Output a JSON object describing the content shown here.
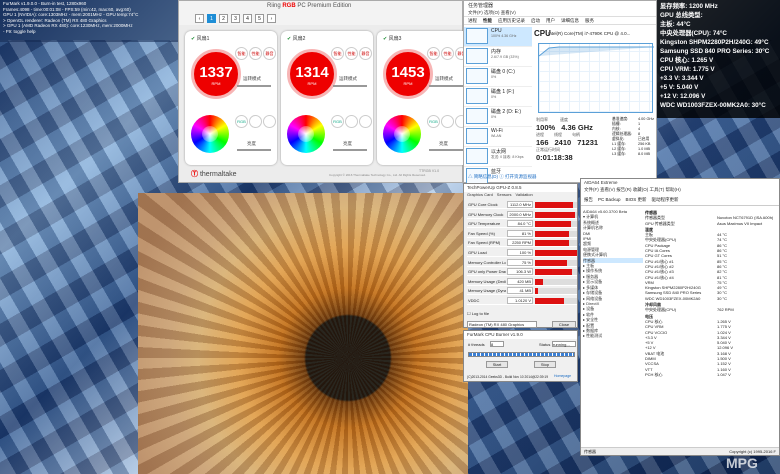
{
  "overlay_tl": {
    "lines": [
      "FurMark v1.9.0.0 - Burn-in test, 1280x960",
      "Frames:4098 - time:00:01:08 - FPS:59 (min:42, max:60, avg:60)",
      "GPU 1 (NVIDIA): core:1303MHz - mem:2001MHz - GPU temp:74°C",
      "> OpenGL renderer: Radeon (TM) RX 480 Graphics",
      "> GPU 1 (AMD Radeon RX 480): core:1230MHz, mem:2000MHz",
      "- F9: toggle help"
    ]
  },
  "tt": {
    "title_pre": "Riing ",
    "title_brand": "RGB",
    "title_post": " PC Premium Edition",
    "pages": [
      "1",
      "2",
      "3",
      "4",
      "5"
    ],
    "brand_pre": "Ⓣ ",
    "brand": "thermaltake",
    "fans": [
      {
        "label": "风扇1",
        "rpm": "1337",
        "unit": "RPM",
        "mode": "运转模式",
        "brightness": "亮度"
      },
      {
        "label": "风扇2",
        "rpm": "1314",
        "unit": "RPM",
        "mode": "运转模式",
        "brightness": "亮度"
      },
      {
        "label": "风扇3",
        "rpm": "1453",
        "unit": "RPM",
        "mode": "运转模式",
        "brightness": "亮度"
      }
    ],
    "mini": [
      "智能",
      "性能",
      "静音"
    ],
    "rgb": "RGB",
    "footer": "Copyright © 2016 Thermaltake Technology Co., Ltd. All Rights Reserved.",
    "version": "TTRGB V1.0"
  },
  "tm": {
    "title": "任务管理器",
    "menu": "文件(F)  选项(O)  查看(V)",
    "tabs": [
      "进程",
      "性能",
      "应用历史记录",
      "启动",
      "用户",
      "详细信息",
      "服务"
    ],
    "side": [
      {
        "name": "CPU",
        "sub": "100% 4.36 GHz"
      },
      {
        "name": "内存",
        "sub": "2.6/7.9 GB (33%)"
      },
      {
        "name": "磁盘 0 (C:)",
        "sub": "0%"
      },
      {
        "name": "磁盘 1 (F:)",
        "sub": "0%"
      },
      {
        "name": "磁盘 2 (D: E:)",
        "sub": "0%"
      },
      {
        "name": "Wi-Fi",
        "sub": "WLAN"
      },
      {
        "name": "以太网",
        "sub": "发送: 0 接收: 8 Kbps"
      },
      {
        "name": "蓝牙",
        "sub": ""
      }
    ],
    "cpu_title": "CPU",
    "cpu_name": "Intel(R) Core(TM) i7-4790K CPU @ 4.0...",
    "util_label": "利用率",
    "speed_label": "速度",
    "util": "100%",
    "speed": "4.36 GHz",
    "proc_label": "进程",
    "thr_label": "线程",
    "handle_label": "句柄",
    "proc": "166",
    "thr": "2410",
    "handle": "71231",
    "uptime_label": "正常运行时间",
    "uptime": "0:01:18:38",
    "details": [
      "基准速度:",
      "4.00 GHz",
      "插槽:",
      "1",
      "内核:",
      "4",
      "逻辑处理器:",
      "8",
      "虚拟化:",
      "已启用",
      "L1 缓存:",
      "256 KB",
      "L2 缓存:",
      "1.0 MB",
      "L3 缓存:",
      "8.0 MB"
    ],
    "footer": "△ 简略信息(D)   ⓘ 打开资源监视器"
  },
  "rov": {
    "lines": [
      "显存频率: 1200 MHz",
      "GPU 总线类型:",
      "主板: 44°C",
      "中央处理器(CPU): 74°C",
      "Kingston SHPM2280P2H/240G: 49°C",
      "Samsung SSD 840 PRO Series: 30°C",
      "CPU 核心: 1.265 V",
      "CPU VRM: 1.775 V",
      "+3.3 V: 3.344 V",
      "+5 V: 5.040 V",
      "+12 V: 12.096 V",
      "WDC WD1003FZEX-00MK2A0: 30°C"
    ]
  },
  "gz": {
    "title": "TechPowerUp GPU-Z 0.8.5",
    "tabs": [
      "Graphics Card",
      "Sensors",
      "Validation"
    ],
    "rows": [
      {
        "k": "GPU Core Clock",
        "v": "1112.0 MHz",
        "p": 90
      },
      {
        "k": "GPU Memory Clock",
        "v": "2000.0 MHz",
        "p": 95
      },
      {
        "k": "GPU Temperature",
        "v": "84.0 °C",
        "p": 85
      },
      {
        "k": "Fan Speed (%)",
        "v": "81 %",
        "p": 80
      },
      {
        "k": "Fan Speed (RPM)",
        "v": "2250 RPM",
        "p": 82
      },
      {
        "k": "GPU Load",
        "v": "100 %",
        "p": 100
      },
      {
        "k": "Memory Controller Load",
        "v": "75 %",
        "p": 75
      },
      {
        "k": "GPU only Power Draw",
        "v": "106.3 W",
        "p": 88
      },
      {
        "k": "Memory Usage (Dedicated)",
        "v": "420 MB",
        "p": 20
      },
      {
        "k": "Memory Usage (Dynamic)",
        "v": "41 MB",
        "p": 6
      },
      {
        "k": "VDDC",
        "v": "1.0120 V",
        "p": 70
      }
    ],
    "log": "Log to file",
    "card": "Radeon (TM) RX 480 Graphics",
    "close": "Close"
  },
  "st": {
    "title": "FurMark CPU Burner v1.9.0",
    "threads_label": "# threads",
    "threads": "8",
    "status_label": "Status",
    "status": "running...",
    "start": "Start",
    "stop": "Stop",
    "footer": "(C)2013-2014 Geeks3D - Build Nov 10 2014@22:39:19",
    "homepage": "Homepage"
  },
  "ai": {
    "title": "AIDA64 Extreme",
    "menu": "文件(F)  查看(V)  报告(R)  收藏(O)  工具(T)  帮助(H)",
    "tool": [
      "报告",
      "PC Backup",
      "BIOS 更新",
      "驱动程序更新"
    ],
    "tree": [
      "AIDA64 v5.60.3700 Beta",
      "▾ 计算机",
      "  系统概述",
      "  计算机名称",
      "  DMI",
      "  IPMI",
      "  超频",
      "  电源管理",
      "  便携式计算机",
      "  传感器",
      "▸ 主板",
      "▸ 操作系统",
      "▸ 服务器",
      "▸ 显示设备",
      "▸ 多媒体",
      "▸ 存储设备",
      "▸ 网络设备",
      "▸ DirectX",
      "▸ 设备",
      "▸ 软件",
      "▸ 安全性",
      "▸ 配置",
      "▸ 数据库",
      "▸ 性能测试"
    ],
    "list": [
      {
        "sec": "传感器"
      },
      {
        "k": "传感器类型",
        "v": "Nuvoton NCT6791D (ISA A00h)"
      },
      {
        "k": "GPU 传感器类型",
        "v": "Asus Maximus VII Impact"
      },
      {
        "sec": "温度"
      },
      {
        "k": "主板",
        "v": "44 °C"
      },
      {
        "k": "中央处理器(CPU)",
        "v": "74 °C"
      },
      {
        "k": "CPU Package",
        "v": "86 °C"
      },
      {
        "k": "CPU IA Cores",
        "v": "86 °C"
      },
      {
        "k": "CPU GT Cores",
        "v": "51 °C"
      },
      {
        "k": "CPU #1/核心 #1",
        "v": "85 °C"
      },
      {
        "k": "CPU #1/核心 #2",
        "v": "86 °C"
      },
      {
        "k": "CPU #1/核心 #3",
        "v": "82 °C"
      },
      {
        "k": "CPU #1/核心 #4",
        "v": "81 °C"
      },
      {
        "k": "VRM",
        "v": "75 °C"
      },
      {
        "k": "Kingston SHPM2280P2H/240G",
        "v": "49 °C"
      },
      {
        "k": "Samsung SSD 840 PRO Series",
        "v": "30 °C"
      },
      {
        "k": "WDC WD1003FZEX-00MK2A0",
        "v": "30 °C"
      },
      {
        "sec": "冷却风扇"
      },
      {
        "k": "中央处理器(CPU)",
        "v": "762 RPM"
      },
      {
        "sec": "电压"
      },
      {
        "k": "CPU 核心",
        "v": "1.265 V"
      },
      {
        "k": "CPU VRM",
        "v": "1.775 V"
      },
      {
        "k": "CPU VCCIO",
        "v": "1.024 V"
      },
      {
        "k": "+3.3 V",
        "v": "3.344 V"
      },
      {
        "k": "+5 V",
        "v": "5.040 V"
      },
      {
        "k": "+12 V",
        "v": "12.096 V"
      },
      {
        "k": "VBAT 电池",
        "v": "3.168 V"
      },
      {
        "k": "DIMM",
        "v": "1.500 V"
      },
      {
        "k": "VCCSA",
        "v": "1.152 V"
      },
      {
        "k": "VTT",
        "v": "1.160 V"
      },
      {
        "k": "PCH 核心",
        "v": "1.047 V"
      }
    ],
    "foot_l": "传感器",
    "foot_r": "Copyright (c) 1995-2016 F"
  },
  "logo": "MPG"
}
